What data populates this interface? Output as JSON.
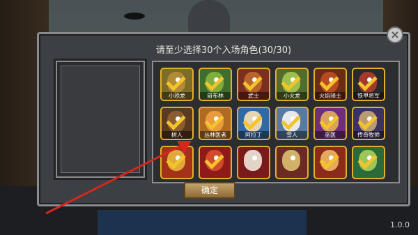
{
  "dialog": {
    "title": "请至少选择30个入场角色(30/30)",
    "confirm_label": "确定"
  },
  "close_icon": "×",
  "version": "1.0.0",
  "characters": [
    {
      "name": "小恐龙",
      "bg": "#7c6c2a",
      "face": "#b18b36",
      "selected": true
    },
    {
      "name": "哥布林",
      "bg": "#3f6d2d",
      "face": "#7fae3d",
      "selected": true
    },
    {
      "name": "武士",
      "bg": "#7b2f1f",
      "face": "#b8652d",
      "selected": true
    },
    {
      "name": "小火龙",
      "bg": "#536c2c",
      "face": "#9bc04c",
      "selected": true
    },
    {
      "name": "火焰骑士",
      "bg": "#6a2b17",
      "face": "#b74a20",
      "selected": true
    },
    {
      "name": "铁甲将军",
      "bg": "#2a2a2a",
      "face": "#a33a2c",
      "selected": true
    },
    {
      "name": "树人",
      "bg": "#5a3a20",
      "face": "#8a5e32",
      "selected": true
    },
    {
      "name": "丛林医者",
      "bg": "#b06b22",
      "face": "#e99b3d",
      "selected": true
    },
    {
      "name": "阿拉丁",
      "bg": "#2f69a6",
      "face": "#e6d5b2",
      "selected": true
    },
    {
      "name": "雪人",
      "bg": "#577a9e",
      "face": "#e8e8ea",
      "selected": true
    },
    {
      "name": "巫医",
      "bg": "#6e2e7b",
      "face": "#d9a25f",
      "selected": true
    },
    {
      "name": "传奇牧师",
      "bg": "#3d3162",
      "face": "#b99b72",
      "selected": true
    },
    {
      "name": "",
      "bg": "#a33218",
      "face": "#e1a93a",
      "selected": true
    },
    {
      "name": "",
      "bg": "#8e1a1a",
      "face": "#d14b2a",
      "selected": true
    },
    {
      "name": "",
      "bg": "#7b1a1a",
      "face": "#e4d4c8",
      "selected": false
    },
    {
      "name": "",
      "bg": "#6b2a22",
      "face": "#d2b06a",
      "selected": false
    },
    {
      "name": "",
      "bg": "#8c2b1a",
      "face": "#e5a95b",
      "selected": true
    },
    {
      "name": "",
      "bg": "#2c6a3a",
      "face": "#9ac758",
      "selected": true
    }
  ]
}
